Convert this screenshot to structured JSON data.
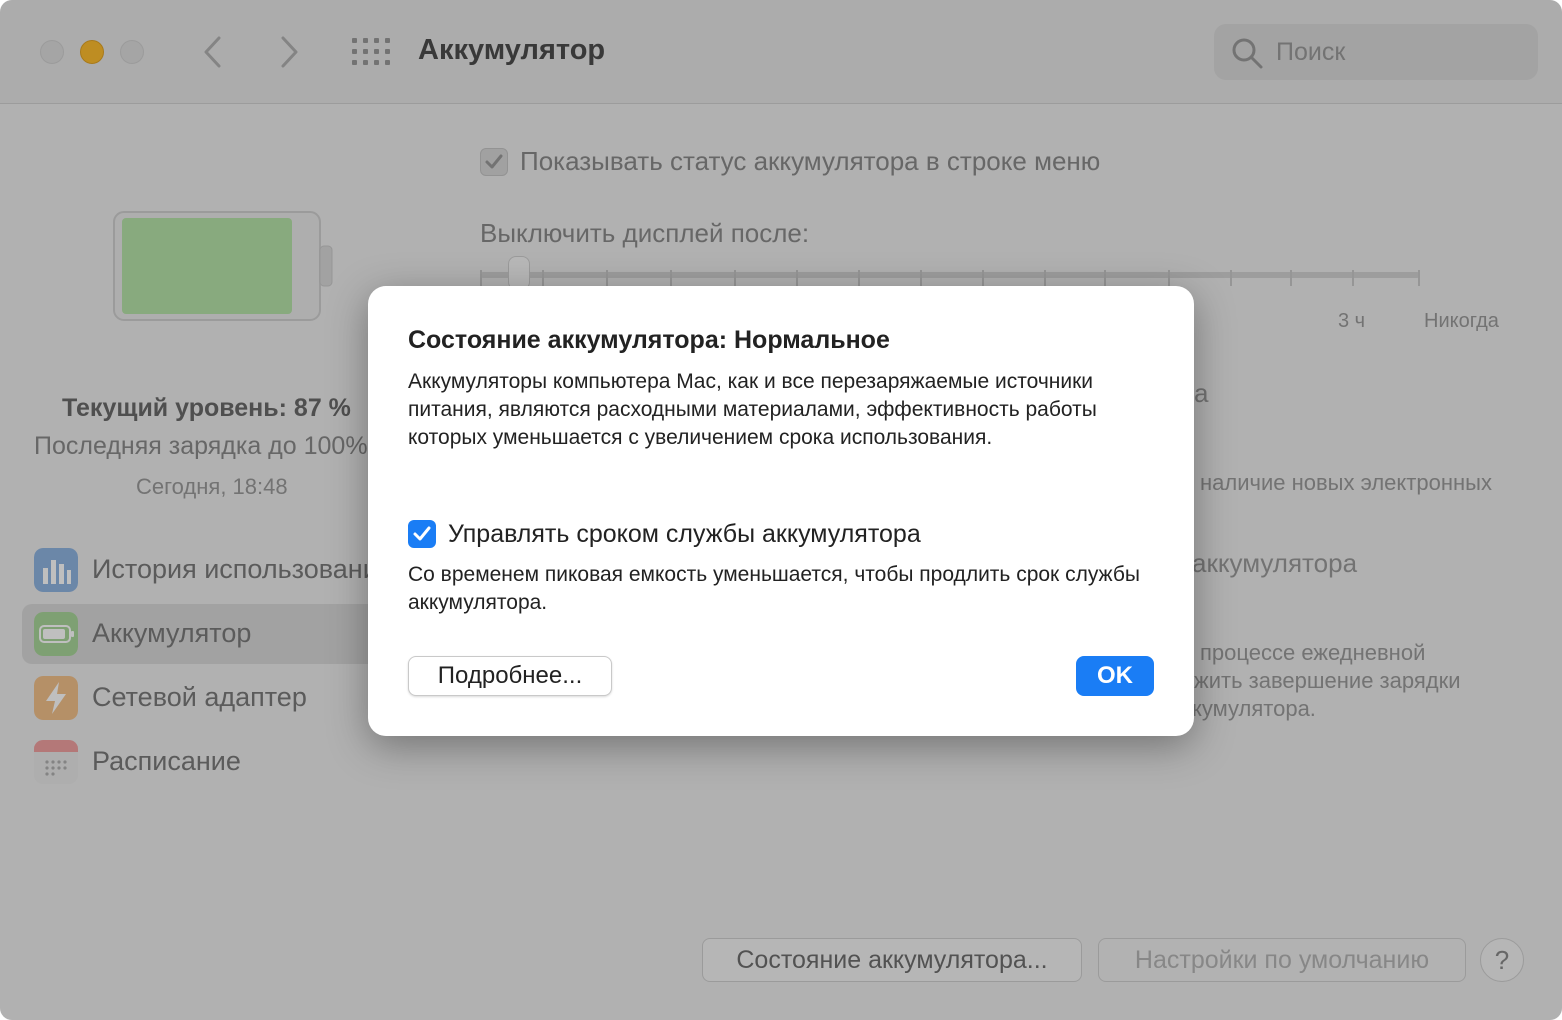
{
  "window": {
    "title": "Аккумулятор",
    "search_placeholder": "Поиск"
  },
  "sidebar": {
    "level": "Текущий уровень: 87 %",
    "last_charge": "Последняя зарядка до 100%",
    "charge_time": "Сегодня, 18:48",
    "items": [
      {
        "label": "История использования"
      },
      {
        "label": "Аккумулятор"
      },
      {
        "label": "Сетевой адаптер"
      },
      {
        "label": "Расписание"
      }
    ]
  },
  "main": {
    "show_status_label": "Показывать статус аккумулятора в строке меню",
    "display_off_label": "Выключить дисплей после:",
    "tick_3h": "3 ч",
    "tick_never": "Никогда",
    "frag_1": "а",
    "frag_2": "наличие новых электронных",
    "frag_3": "аккумулятора",
    "frag_4": "процессе ежедневной",
    "frag_5": "жить завершение зарядки",
    "frag_6": "кумулятора."
  },
  "bottom": {
    "battery_health_button": "Состояние аккумулятора...",
    "defaults_button": "Настройки по умолчанию",
    "help_button": "?"
  },
  "dialog": {
    "title": "Состояние аккумулятора: Нормальное",
    "body": "Аккумуляторы компьютера Mac, как и все перезаряжаемые источники питания, являются расходными материалами, эффективность работы которых уменьшается с увеличением срока использования.",
    "checkbox_label": "Управлять сроком службы аккумулятора",
    "checkbox_checked": true,
    "checkbox_desc": "Со временем пиковая емкость уменьшается, чтобы продлить срок службы аккумулятора.",
    "more_button": "Подробнее...",
    "ok_button": "OK"
  },
  "colors": {
    "accent": "#1a7df5",
    "minimize": "#febc2e",
    "battery_fill": "#b6e3a8"
  }
}
